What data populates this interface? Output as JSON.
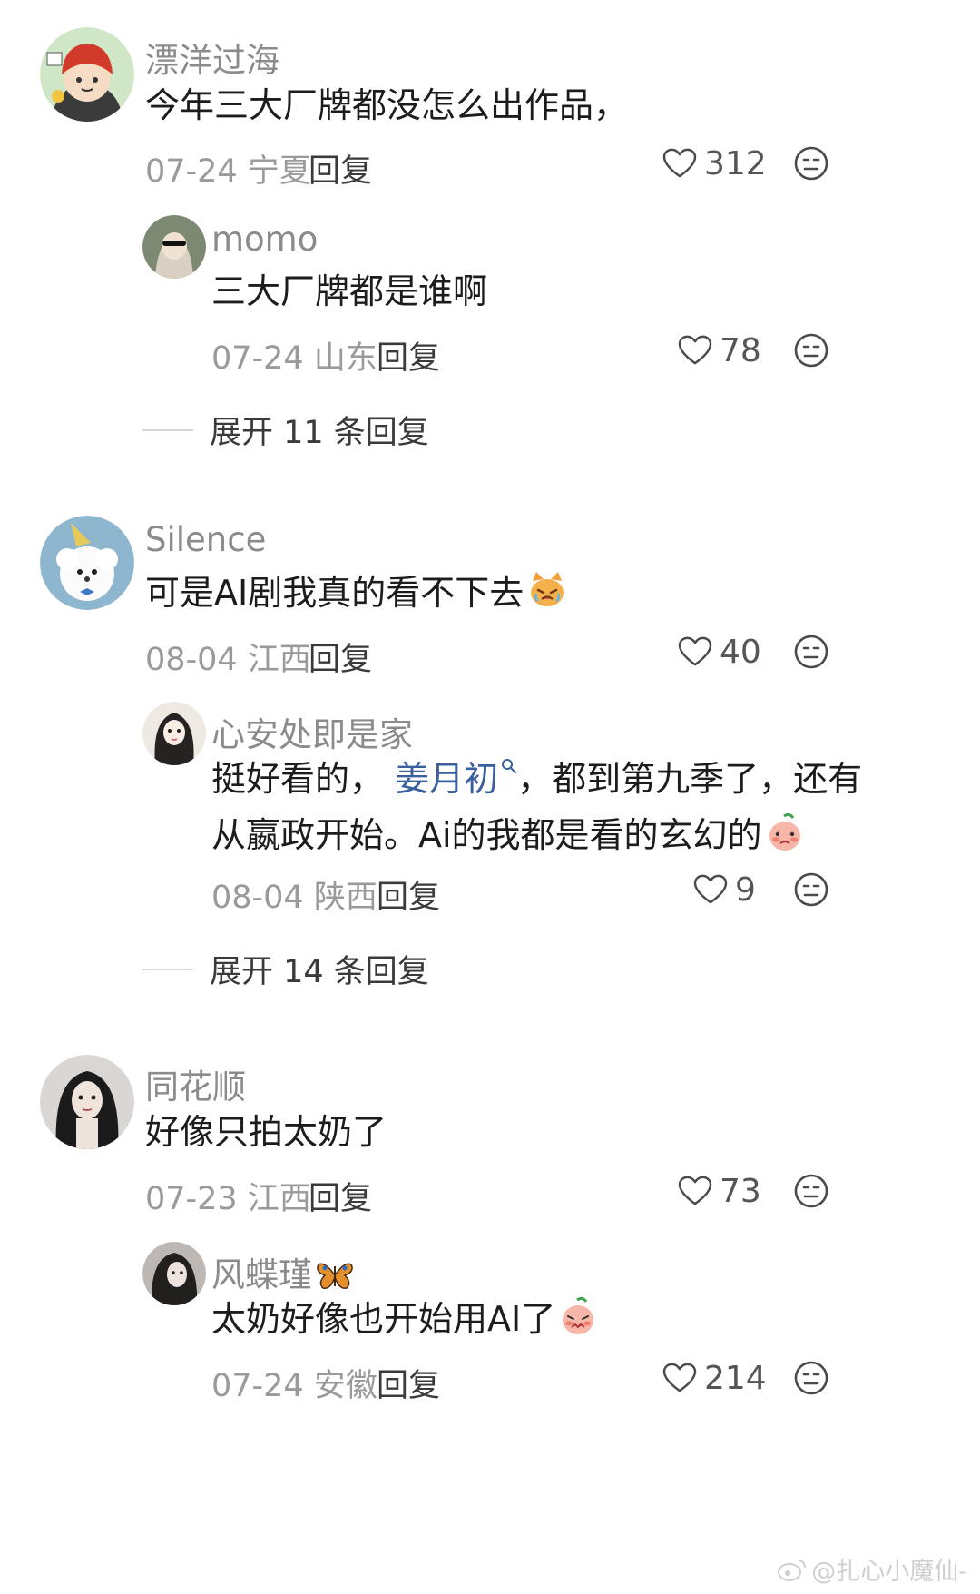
{
  "comments": [
    {
      "user": "漂洋过海",
      "text": "今年三大厂牌都没怎么出作品，",
      "date": "07-24",
      "location": "宁夏",
      "reply_label": "回复",
      "likes": "312",
      "avatar_icon": "cartoon-boy-red-hat-avatar",
      "replies": [
        {
          "user": "momo",
          "text": "三大厂牌都是谁啊",
          "date": "07-24",
          "location": "山东",
          "reply_label": "回复",
          "likes": "78",
          "avatar_icon": "person-sunglasses-avatar"
        }
      ],
      "expand_label": "展开 11 条回复"
    },
    {
      "user": "Silence",
      "text": "可是AI剧我真的看不下去",
      "text_emoji": "crying-cat-emoji",
      "date": "08-04",
      "location": "江西",
      "reply_label": "回复",
      "likes": "40",
      "avatar_icon": "white-dog-party-hat-avatar",
      "replies": [
        {
          "user": "心安处即是家",
          "text_prefix": "挺好看的，",
          "mention": "姜月初",
          "text_line1_suffix": "，都到第九季了，还有",
          "text_line2": "从嬴政开始。Ai的我都是看的玄幻的",
          "text_emoji": "shy-peach-emoji",
          "date": "08-04",
          "location": "陕西",
          "reply_label": "回复",
          "likes": "9",
          "avatar_icon": "anime-girl-avatar"
        }
      ],
      "expand_label": "展开 14 条回复"
    },
    {
      "user": "同花顺",
      "text": "好像只拍太奶了",
      "date": "07-23",
      "location": "江西",
      "reply_label": "回复",
      "likes": "73",
      "avatar_icon": "woman-portrait-avatar",
      "replies": [
        {
          "user": "风蝶瑾",
          "user_emoji": "butterfly-icon",
          "text": "太奶好像也开始用AI了",
          "text_emoji": "shy-peach-emoji",
          "date": "07-24",
          "location": "安徽",
          "reply_label": "回复",
          "likes": "214",
          "avatar_icon": "woman-dark-hair-avatar"
        }
      ]
    }
  ],
  "watermark": "@扎心小魔仙-",
  "colors": {
    "username": "#8b8b8b",
    "text": "#1c1c1c",
    "meta": "#9a9a9a",
    "mention": "#3a5f9e",
    "background": "#ffffff"
  }
}
